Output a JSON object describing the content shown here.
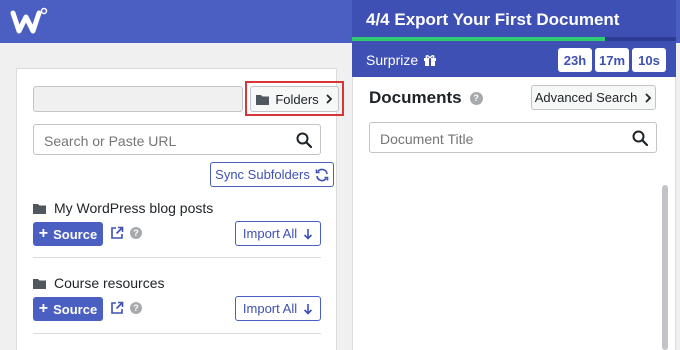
{
  "export_panel": {
    "title": "4/4  Export Your First Document",
    "progress_fraction": 0.78,
    "surprize_label": "Surprize",
    "timer": {
      "hours": "23h",
      "minutes": "17m",
      "seconds": "10s"
    }
  },
  "left": {
    "folders_label": "Folders",
    "search_placeholder": "Search or Paste URL",
    "sync_label": "Sync Subfolders",
    "source_label": "Source",
    "import_label": "Import All",
    "folders": [
      {
        "name": "My WordPress blog posts"
      },
      {
        "name": "Course resources"
      }
    ]
  },
  "right": {
    "title": "Documents",
    "advanced_search_label": "Advanced Search",
    "doc_search_placeholder": "Document Title"
  },
  "colors": {
    "brand": "#4a5fc1",
    "brand_dark": "#3e50b4",
    "progress": "#2ecc71",
    "highlight": "#d63638"
  },
  "icons": [
    "logo-icon",
    "gift-icon",
    "folder-icon",
    "chevron-right-icon",
    "search-icon",
    "sync-icon",
    "plus-icon",
    "external-link-icon",
    "help-icon",
    "arrow-down-icon"
  ]
}
